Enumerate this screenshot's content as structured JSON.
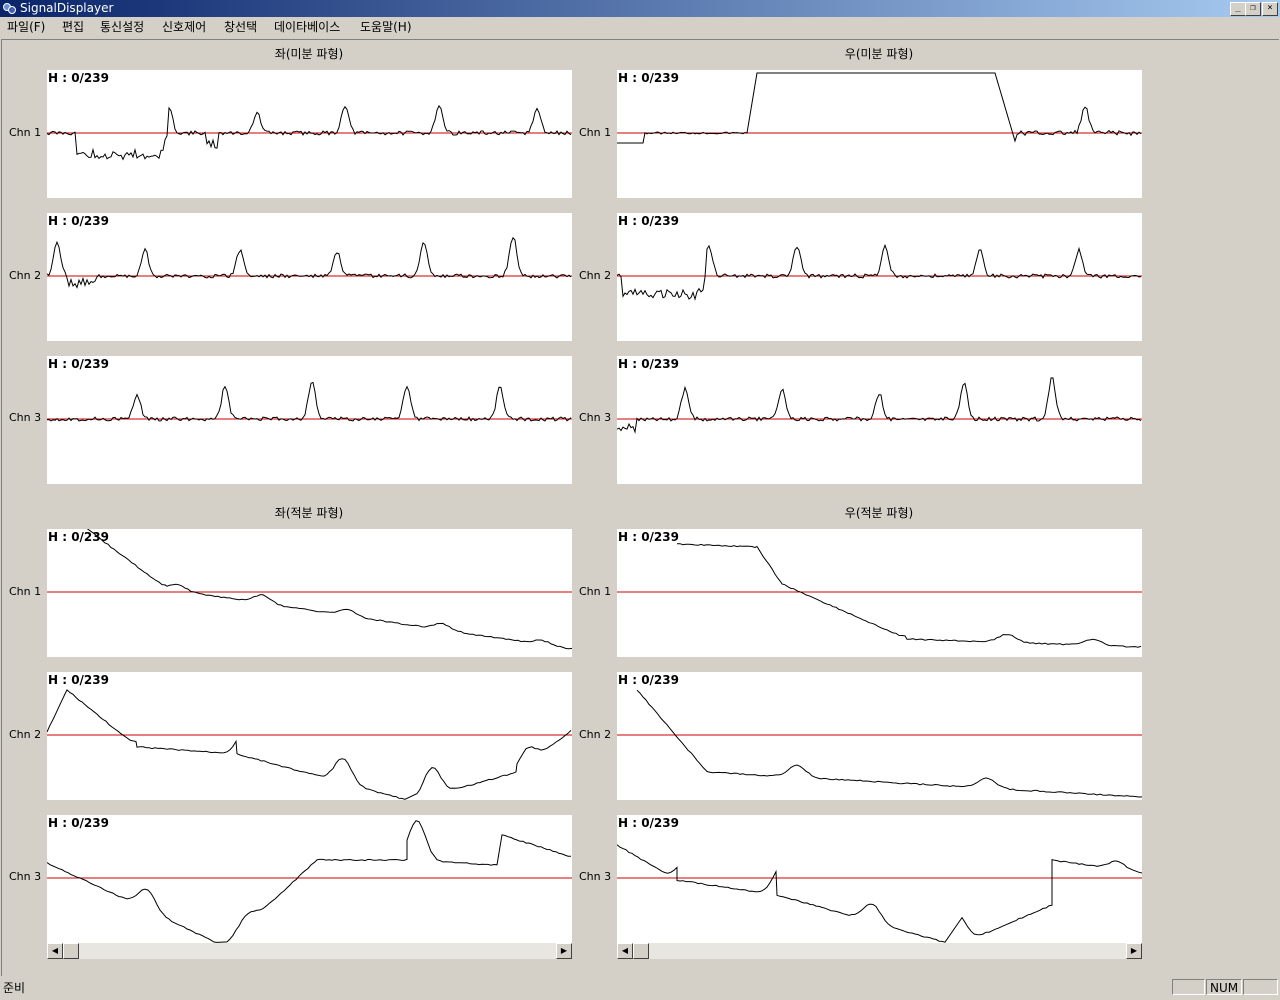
{
  "window": {
    "title": "SignalDisplayer",
    "controls": [
      "_",
      "❐",
      "×"
    ]
  },
  "menu": [
    "파일(F)",
    "편집",
    "통신설정",
    "신호제어",
    "창선택",
    "데이타베이스",
    "도움말(H)"
  ],
  "sections": {
    "left_diff": "좌(미분 파형)",
    "right_diff": "우(미분 파형)",
    "left_integ": "좌(적분 파형)",
    "right_integ": "우(적분 파형)"
  },
  "channels": [
    "Chn 1",
    "Chn 2",
    "Chn 3"
  ],
  "plot_header": "H : 0/239",
  "scroll": {
    "left_arrow": "◀",
    "right_arrow": "▶"
  },
  "status": {
    "text": "준비",
    "pane_empty": "",
    "num": "NUM",
    "pane_last": ""
  },
  "colors": {
    "baseline": "#cc0000",
    "signal": "#000000",
    "background": "#d4d0c8"
  }
}
